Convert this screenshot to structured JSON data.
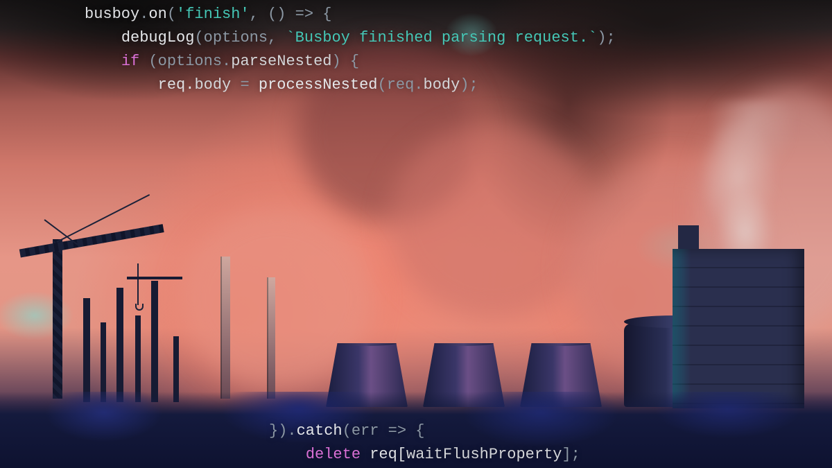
{
  "code": {
    "top": {
      "l1": {
        "a": "busboy",
        "b": ".",
        "c": "on",
        "d": "(",
        "e": "'finish'",
        "f": ", () ",
        "g": "=>",
        "h": " {"
      },
      "l2": {
        "indent": "    ",
        "a": "debugLog",
        "b": "(options, ",
        "c": "`Busboy finished parsing request.`",
        "d": ");"
      },
      "l3": {
        "indent": "    ",
        "a": "if",
        "b": " (options.",
        "c": "parseNested",
        "d": ") {"
      },
      "l4": {
        "indent": "        ",
        "a": "req.",
        "b": "body",
        "c": " = ",
        "d": "processNested",
        "e": "(req.",
        "f": "body",
        "g": ");"
      }
    },
    "bottom": {
      "l1": {
        "a": "}).",
        "b": "catch",
        "c": "(err ",
        "d": "=>",
        "e": " {"
      },
      "l2": {
        "indent": "    ",
        "a": "delete",
        "b": " req[",
        "c": "waitFlushProperty",
        "d": "];"
      }
    }
  }
}
